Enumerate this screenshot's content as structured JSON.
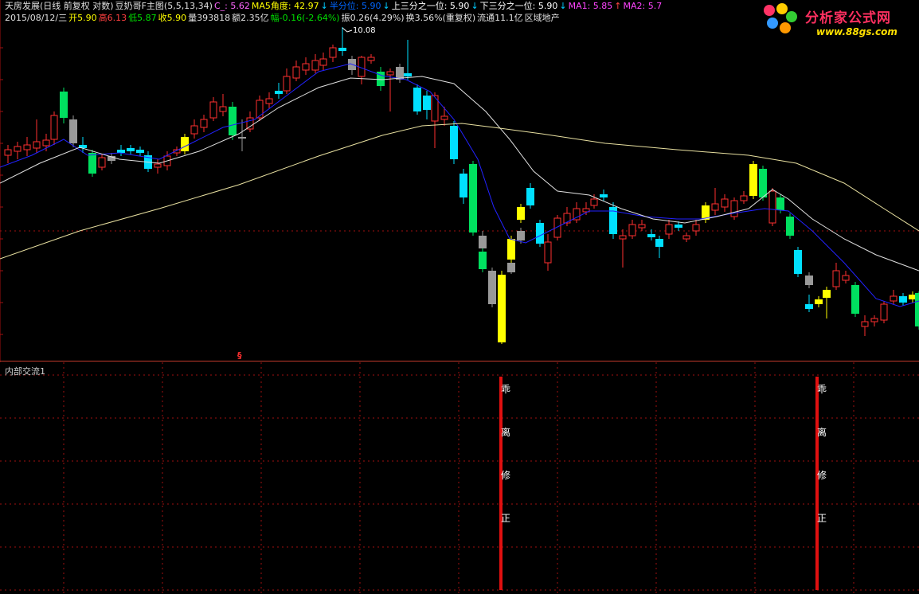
{
  "header": {
    "line1": [
      {
        "text": "天房发展(日线 前复权 对数)",
        "color": "#e0e0e0"
      },
      {
        "text": "豆奶哥F主图(5,5,13,34)",
        "color": "#e0e0e0"
      },
      {
        "text": "C_: 5.62",
        "color": "#ff66ff"
      },
      {
        "text": "MA5角度: 42.97",
        "color": "#ffff00"
      },
      {
        "text": "↓",
        "color": "#00ccff"
      },
      {
        "text": "半分位: 5.90",
        "color": "#0066ff"
      },
      {
        "text": "↓",
        "color": "#00ccff"
      },
      {
        "text": "上三分之一位: 5.90",
        "color": "#ffffff"
      },
      {
        "text": "↓",
        "color": "#00ccff"
      },
      {
        "text": "下三分之一位: 5.90",
        "color": "#ffffff"
      },
      {
        "text": "↓",
        "color": "#00ccff"
      },
      {
        "text": "MA1: 5.85",
        "color": "#ff44ff"
      },
      {
        "text": "↑",
        "color": "#ff4444"
      },
      {
        "text": "MA2: 5.7",
        "color": "#ff44ff"
      }
    ],
    "line2": [
      {
        "text": "2015/08/12/三",
        "color": "#e0e0e0"
      },
      {
        "text": "开5.90",
        "color": "#ffff00"
      },
      {
        "text": "高6.13",
        "color": "#ff4040"
      },
      {
        "text": "低5.87",
        "color": "#00e000"
      },
      {
        "text": "收5.90",
        "color": "#ffff00"
      },
      {
        "text": "量393818",
        "color": "#e0e0e0"
      },
      {
        "text": "额2.35亿",
        "color": "#e0e0e0"
      },
      {
        "text": "幅-0.16(-2.64%)",
        "color": "#00e000"
      },
      {
        "text": "振0.26(4.29%)",
        "color": "#e0e0e0"
      },
      {
        "text": "换3.56%(重复权)",
        "color": "#e0e0e0"
      },
      {
        "text": "流通11.1亿",
        "color": "#e0e0e0"
      },
      {
        "text": "区域地产",
        "color": "#e0e0e0"
      }
    ]
  },
  "logo": {
    "name": "分析家公式网",
    "url": "www.88gs.com"
  },
  "peak_label": "10.08",
  "signal_mark": "§",
  "bottom_panel": {
    "title": "内部交流1",
    "signal_text": [
      "乖",
      "离",
      "修",
      "正"
    ]
  },
  "colors": {
    "up": "#ff3030",
    "down": "#00e0ff",
    "yellow": "#ffff00",
    "gray": "#999999",
    "green": "#00e060",
    "ma_blue": "#2222ff",
    "ma_white": "#e0e0e0",
    "ma_yellow": "#e8e0a0",
    "grid": "#a01010",
    "signal": "#e01010"
  }
}
